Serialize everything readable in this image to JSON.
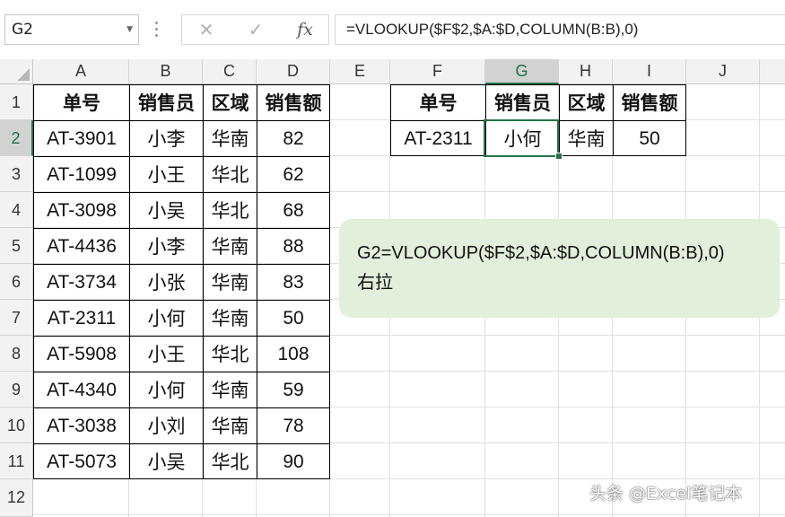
{
  "name_box": "G2",
  "formula_bar": {
    "cancel_icon": "cancel-x-icon",
    "enter_icon": "check-icon",
    "fx_label": "fx",
    "formula": "=VLOOKUP($F$2,$A:$D,COLUMN(B:B),0)"
  },
  "columns": [
    "A",
    "B",
    "C",
    "D",
    "E",
    "F",
    "G",
    "H",
    "I",
    "J"
  ],
  "rows": [
    "1",
    "2",
    "3",
    "4",
    "5",
    "6",
    "7",
    "8",
    "9",
    "10",
    "11",
    "12"
  ],
  "source_table": {
    "headers": [
      "单号",
      "销售员",
      "区域",
      "销售额"
    ],
    "rows": [
      [
        "AT-3901",
        "小李",
        "华南",
        "82"
      ],
      [
        "AT-1099",
        "小王",
        "华北",
        "62"
      ],
      [
        "AT-3098",
        "小吴",
        "华北",
        "68"
      ],
      [
        "AT-4436",
        "小李",
        "华南",
        "88"
      ],
      [
        "AT-3734",
        "小张",
        "华南",
        "83"
      ],
      [
        "AT-2311",
        "小何",
        "华南",
        "50"
      ],
      [
        "AT-5908",
        "小王",
        "华北",
        "108"
      ],
      [
        "AT-4340",
        "小何",
        "华南",
        "59"
      ],
      [
        "AT-3038",
        "小刘",
        "华南",
        "78"
      ],
      [
        "AT-5073",
        "小吴",
        "华北",
        "90"
      ]
    ]
  },
  "lookup_table": {
    "headers": [
      "单号",
      "销售员",
      "区域",
      "销售额"
    ],
    "values": [
      "AT-2311",
      "小何",
      "华南",
      "50"
    ]
  },
  "note": {
    "line1": "G2=VLOOKUP($F$2,$A:$D,COLUMN(B:B),0)",
    "line2": "右拉"
  },
  "watermark": "头条 @Excel笔记本",
  "colors": {
    "selection": "#217346",
    "note_bg": "#e2efda"
  }
}
